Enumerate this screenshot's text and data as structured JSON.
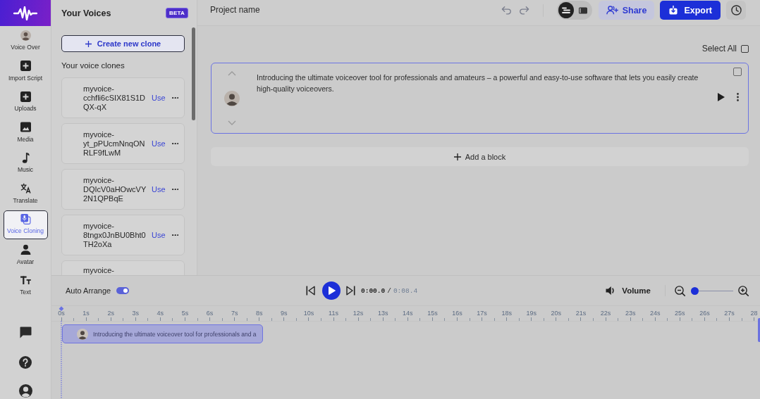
{
  "nav": {
    "items": [
      {
        "kind": "portrait",
        "label": "Voice Over",
        "selected": false
      },
      {
        "kind": "plus",
        "label": "Import Script",
        "selected": false
      },
      {
        "kind": "plus",
        "label": "Uploads",
        "selected": false
      },
      {
        "kind": "image",
        "label": "Media",
        "selected": false
      },
      {
        "kind": "note",
        "label": "Music",
        "selected": false
      },
      {
        "kind": "translate",
        "label": "Translate",
        "selected": false
      },
      {
        "kind": "clone",
        "label": "Voice Cloning",
        "selected": true
      },
      {
        "kind": "person",
        "label": "Avatar",
        "selected": false
      },
      {
        "kind": "text",
        "label": "Text",
        "selected": false
      }
    ]
  },
  "voices_panel": {
    "title": "Your Voices",
    "badge": "BETA",
    "create_button": "Create new clone",
    "section_title": "Your voice clones",
    "clones": [
      {
        "name": "myvoice-cchfli6cSIX81S1DQX-qX",
        "action": "Use"
      },
      {
        "name": "myvoice-yt_pPUcmNnqONRLF9fLwM",
        "action": "Use"
      },
      {
        "name": "myvoice-DQIcV0aHOwcVY2N1QPBqE",
        "action": "Use"
      },
      {
        "name": "myvoice-8tngx0JnBU0Bht0TH2oXa",
        "action": "Use"
      },
      {
        "name": "myvoice-"
      }
    ]
  },
  "editor": {
    "project_name": "Project name",
    "view_modes": [
      {
        "kind": "script",
        "selected": true
      },
      {
        "kind": "video",
        "selected": false
      }
    ],
    "share": "Share",
    "export": "Export",
    "select_all": {
      "label": "Select All",
      "checked": false
    },
    "blocks": [
      {
        "text": "Introducing the ultimate voiceover tool for professionals and amateurs – a powerful and easy-to-use software that lets you easily create high-quality voiceovers.",
        "selected": true,
        "checked": false
      }
    ],
    "add_block": "Add a block"
  },
  "timeline": {
    "auto_arrange": {
      "label": "Auto Arrange",
      "on": true
    },
    "time": {
      "current": "0:00.0",
      "separator": "/",
      "total": "0:08.4"
    },
    "volume": "Volume",
    "zoom": {
      "level": 0
    },
    "ruler": [
      "0s",
      "1s",
      "2s",
      "3s",
      "4s",
      "5s",
      "6s",
      "7s",
      "8s",
      "9s",
      "10s",
      "11s",
      "12s",
      "13s",
      "14s",
      "15s",
      "16s",
      "17s",
      "18s",
      "19s",
      "20s",
      "21s",
      "22s",
      "23s",
      "24s",
      "25s",
      "26s",
      "27s",
      "28"
    ],
    "clips": [
      {
        "text": "Introducing the ultimate voiceover tool for professionals and a"
      }
    ]
  }
}
